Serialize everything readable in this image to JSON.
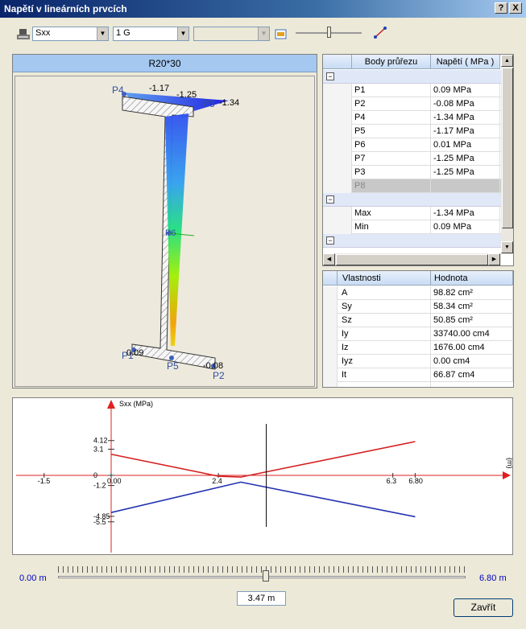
{
  "window": {
    "title": "Napětí v lineárních prvcích",
    "help": "?",
    "close": "X"
  },
  "toolbar": {
    "quantity": "Sxx",
    "loadcase": "1 G",
    "third": ""
  },
  "section_panel": {
    "title": "R20*30",
    "labels": {
      "p4": "P4",
      "v117": "-1.17",
      "v125": "-1.25",
      "p3": "P3",
      "v134": "-1.34",
      "p6": "P6",
      "p1": "P1",
      "v009": "0.09",
      "p5": "P5",
      "p2": "P2",
      "v008": "-0.08"
    }
  },
  "points_table": {
    "columns": [
      "Body průřezu",
      "Napětí ( MPa )"
    ],
    "rows": [
      {
        "name": "P1",
        "value": "0.09 MPa"
      },
      {
        "name": "P2",
        "value": "-0.08 MPa"
      },
      {
        "name": "P4",
        "value": "-1.34 MPa"
      },
      {
        "name": "P5",
        "value": "-1.17 MPa"
      },
      {
        "name": "P6",
        "value": "0.01 MPa"
      },
      {
        "name": "P7",
        "value": "-1.25 MPa"
      },
      {
        "name": "P3",
        "value": "-1.25 MPa"
      },
      {
        "name": "P8",
        "value": ""
      }
    ],
    "extremes": [
      {
        "name": "Max",
        "value": "-1.34 MPa"
      },
      {
        "name": "Min",
        "value": "0.09 MPa"
      }
    ]
  },
  "props_table": {
    "columns": [
      "Vlastnosti",
      "Hodnota"
    ],
    "rows": [
      {
        "name": "A",
        "value": "98.82 cm²"
      },
      {
        "name": "Sy",
        "value": "58.34 cm²"
      },
      {
        "name": "Sz",
        "value": "50.85 cm²"
      },
      {
        "name": "Iy",
        "value": "33740.00 cm4"
      },
      {
        "name": "Iz",
        "value": "1676.00 cm4"
      },
      {
        "name": "Iyz",
        "value": "0.00 cm4"
      },
      {
        "name": "It",
        "value": "66.87 cm4"
      }
    ]
  },
  "chart_data": {
    "type": "line",
    "ylabel": "Sxx (MPa)",
    "xlabel": "(m)",
    "x_ticks": [
      "-1.5",
      "0.00",
      "2.4",
      "6.3",
      "6.80"
    ],
    "y_ticks": [
      "4.12",
      "3.1",
      "0",
      "-1.2",
      "-4.85",
      "-5.5"
    ],
    "series": [
      {
        "color": "#d42020",
        "points": [
          [
            0,
            2.5
          ],
          [
            2.4,
            -0.1
          ],
          [
            2.9,
            -0.2
          ],
          [
            6.8,
            4.0
          ]
        ]
      },
      {
        "color": "#2030b0",
        "points": [
          [
            0,
            -4.4
          ],
          [
            2.9,
            -0.8
          ],
          [
            6.8,
            -4.9
          ]
        ]
      }
    ],
    "cursor_x": 3.47,
    "xlim": [
      -2.0,
      8.0
    ],
    "ylim": [
      -8.0,
      7.0
    ]
  },
  "slider": {
    "min_label": "0.00 m",
    "max_label": "6.80 m",
    "value": "3.47 m",
    "fraction": 0.51
  },
  "close_button": "Zavřít"
}
